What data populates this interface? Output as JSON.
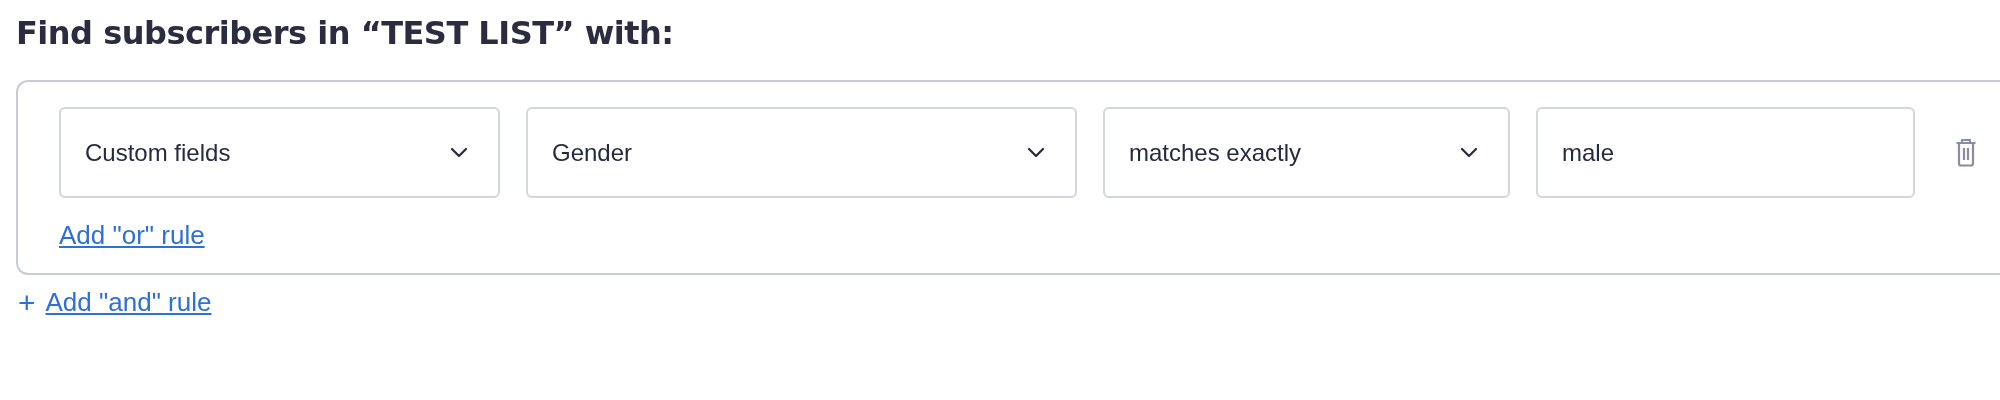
{
  "heading": "Find subscribers in “TEST LIST” with:",
  "rule_group": {
    "rules": [
      {
        "controls": [
          {
            "kind": "select",
            "value": "Custom fields"
          },
          {
            "kind": "select",
            "value": "Gender"
          },
          {
            "kind": "select",
            "value": "matches exactly"
          },
          {
            "kind": "input",
            "value": "male"
          }
        ]
      }
    ],
    "or_link": "Add \"or\" rule"
  },
  "and_link": {
    "icon": "+",
    "label": "Add \"and\" rule"
  }
}
